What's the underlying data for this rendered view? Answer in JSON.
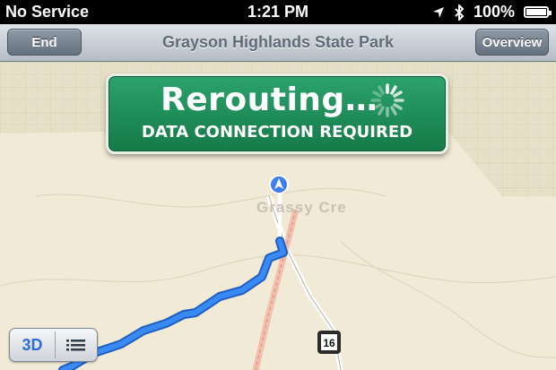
{
  "status_bar": {
    "carrier": "No Service",
    "time": "1:21 PM",
    "battery": "100%",
    "location_icon": "location-arrow-icon",
    "bluetooth_icon": "bluetooth-icon"
  },
  "nav_bar": {
    "title": "Grayson Highlands State Park",
    "end_label": "End",
    "overview_label": "Overview"
  },
  "banner": {
    "headline": "Rerouting…",
    "subtitle": "DATA CONNECTION REQUIRED",
    "spinner_icon": "activity-spinner-icon"
  },
  "map": {
    "place_label": "Grassy Cre",
    "route_shield": "16",
    "colors": {
      "route": "#2f7dea",
      "banner": "#1f8b58",
      "land": "#f1ead6"
    }
  },
  "map_controls": {
    "three_d_label": "3D",
    "list_icon": "list-icon"
  }
}
